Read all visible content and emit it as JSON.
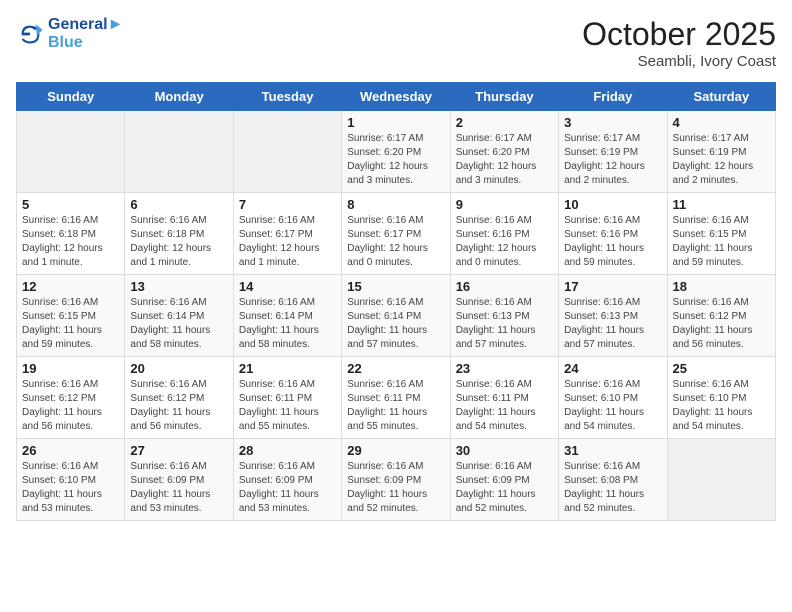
{
  "header": {
    "logo_line1": "General",
    "logo_line2": "Blue",
    "month": "October 2025",
    "location": "Seambli, Ivory Coast"
  },
  "weekdays": [
    "Sunday",
    "Monday",
    "Tuesday",
    "Wednesday",
    "Thursday",
    "Friday",
    "Saturday"
  ],
  "weeks": [
    [
      {
        "day": "",
        "info": ""
      },
      {
        "day": "",
        "info": ""
      },
      {
        "day": "",
        "info": ""
      },
      {
        "day": "1",
        "info": "Sunrise: 6:17 AM\nSunset: 6:20 PM\nDaylight: 12 hours and 3 minutes."
      },
      {
        "day": "2",
        "info": "Sunrise: 6:17 AM\nSunset: 6:20 PM\nDaylight: 12 hours and 3 minutes."
      },
      {
        "day": "3",
        "info": "Sunrise: 6:17 AM\nSunset: 6:19 PM\nDaylight: 12 hours and 2 minutes."
      },
      {
        "day": "4",
        "info": "Sunrise: 6:17 AM\nSunset: 6:19 PM\nDaylight: 12 hours and 2 minutes."
      }
    ],
    [
      {
        "day": "5",
        "info": "Sunrise: 6:16 AM\nSunset: 6:18 PM\nDaylight: 12 hours and 1 minute."
      },
      {
        "day": "6",
        "info": "Sunrise: 6:16 AM\nSunset: 6:18 PM\nDaylight: 12 hours and 1 minute."
      },
      {
        "day": "7",
        "info": "Sunrise: 6:16 AM\nSunset: 6:17 PM\nDaylight: 12 hours and 1 minute."
      },
      {
        "day": "8",
        "info": "Sunrise: 6:16 AM\nSunset: 6:17 PM\nDaylight: 12 hours and 0 minutes."
      },
      {
        "day": "9",
        "info": "Sunrise: 6:16 AM\nSunset: 6:16 PM\nDaylight: 12 hours and 0 minutes."
      },
      {
        "day": "10",
        "info": "Sunrise: 6:16 AM\nSunset: 6:16 PM\nDaylight: 11 hours and 59 minutes."
      },
      {
        "day": "11",
        "info": "Sunrise: 6:16 AM\nSunset: 6:15 PM\nDaylight: 11 hours and 59 minutes."
      }
    ],
    [
      {
        "day": "12",
        "info": "Sunrise: 6:16 AM\nSunset: 6:15 PM\nDaylight: 11 hours and 59 minutes."
      },
      {
        "day": "13",
        "info": "Sunrise: 6:16 AM\nSunset: 6:14 PM\nDaylight: 11 hours and 58 minutes."
      },
      {
        "day": "14",
        "info": "Sunrise: 6:16 AM\nSunset: 6:14 PM\nDaylight: 11 hours and 58 minutes."
      },
      {
        "day": "15",
        "info": "Sunrise: 6:16 AM\nSunset: 6:14 PM\nDaylight: 11 hours and 57 minutes."
      },
      {
        "day": "16",
        "info": "Sunrise: 6:16 AM\nSunset: 6:13 PM\nDaylight: 11 hours and 57 minutes."
      },
      {
        "day": "17",
        "info": "Sunrise: 6:16 AM\nSunset: 6:13 PM\nDaylight: 11 hours and 57 minutes."
      },
      {
        "day": "18",
        "info": "Sunrise: 6:16 AM\nSunset: 6:12 PM\nDaylight: 11 hours and 56 minutes."
      }
    ],
    [
      {
        "day": "19",
        "info": "Sunrise: 6:16 AM\nSunset: 6:12 PM\nDaylight: 11 hours and 56 minutes."
      },
      {
        "day": "20",
        "info": "Sunrise: 6:16 AM\nSunset: 6:12 PM\nDaylight: 11 hours and 56 minutes."
      },
      {
        "day": "21",
        "info": "Sunrise: 6:16 AM\nSunset: 6:11 PM\nDaylight: 11 hours and 55 minutes."
      },
      {
        "day": "22",
        "info": "Sunrise: 6:16 AM\nSunset: 6:11 PM\nDaylight: 11 hours and 55 minutes."
      },
      {
        "day": "23",
        "info": "Sunrise: 6:16 AM\nSunset: 6:11 PM\nDaylight: 11 hours and 54 minutes."
      },
      {
        "day": "24",
        "info": "Sunrise: 6:16 AM\nSunset: 6:10 PM\nDaylight: 11 hours and 54 minutes."
      },
      {
        "day": "25",
        "info": "Sunrise: 6:16 AM\nSunset: 6:10 PM\nDaylight: 11 hours and 54 minutes."
      }
    ],
    [
      {
        "day": "26",
        "info": "Sunrise: 6:16 AM\nSunset: 6:10 PM\nDaylight: 11 hours and 53 minutes."
      },
      {
        "day": "27",
        "info": "Sunrise: 6:16 AM\nSunset: 6:09 PM\nDaylight: 11 hours and 53 minutes."
      },
      {
        "day": "28",
        "info": "Sunrise: 6:16 AM\nSunset: 6:09 PM\nDaylight: 11 hours and 53 minutes."
      },
      {
        "day": "29",
        "info": "Sunrise: 6:16 AM\nSunset: 6:09 PM\nDaylight: 11 hours and 52 minutes."
      },
      {
        "day": "30",
        "info": "Sunrise: 6:16 AM\nSunset: 6:09 PM\nDaylight: 11 hours and 52 minutes."
      },
      {
        "day": "31",
        "info": "Sunrise: 6:16 AM\nSunset: 6:08 PM\nDaylight: 11 hours and 52 minutes."
      },
      {
        "day": "",
        "info": ""
      }
    ]
  ]
}
